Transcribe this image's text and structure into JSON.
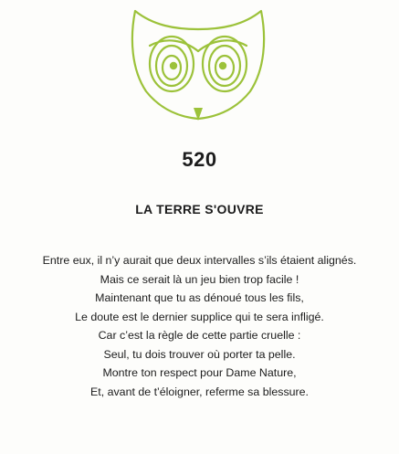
{
  "logo": {
    "icon": "owl-icon",
    "color": "#9cc23a"
  },
  "riddle": {
    "number": "520",
    "title": "LA TERRE S'OUVRE",
    "lines": [
      "Entre eux, il n’y aurait que deux intervalles s’ils étaient alignés.",
      "Mais ce serait là un jeu bien trop facile !",
      "Maintenant que tu as dénoué tous les fils,",
      "Le doute est le dernier supplice qui te sera infligé.",
      "Car c’est la règle de cette partie cruelle :",
      "Seul, tu dois trouver où porter ta pelle.",
      "Montre ton respect pour Dame Nature,",
      "Et, avant de t’éloigner, referme sa blessure."
    ]
  }
}
